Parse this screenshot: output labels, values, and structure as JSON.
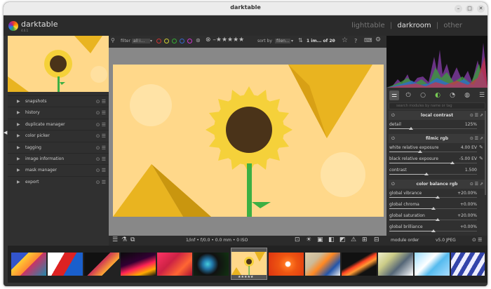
{
  "window": {
    "title": "darktable"
  },
  "app": {
    "name": "darktable",
    "version": "4.6.1"
  },
  "views": {
    "lighttable": "lighttable",
    "darkroom": "darkroom",
    "other": "other",
    "sep": "|"
  },
  "left_panel": {
    "items": [
      {
        "label": "snapshots"
      },
      {
        "label": "history"
      },
      {
        "label": "duplicate manager"
      },
      {
        "label": "color picker"
      },
      {
        "label": "tagging"
      },
      {
        "label": "image information"
      },
      {
        "label": "mask manager"
      },
      {
        "label": "export"
      }
    ]
  },
  "topbar": {
    "filter_label": "filter",
    "filter_value": "all i...",
    "sort_label": "sort by",
    "sort_value": "filen...",
    "count": "1 im... of 20",
    "help": "?",
    "color_labels": [
      "#cc3333",
      "#cccc33",
      "#33aa33",
      "#3366cc",
      "#cc33cc"
    ]
  },
  "bottombar": {
    "exif": "1/inf • f/0.0 • 0.0 mm • 0 ISO"
  },
  "right_panel": {
    "search_placeholder": "search modules by name or tag",
    "modules": {
      "local_contrast": {
        "title": "local contrast",
        "params": [
          {
            "label": "detail",
            "value": "125%",
            "level": 0.25
          }
        ]
      },
      "filmic_rgb": {
        "title": "filmic rgb",
        "params": [
          {
            "label": "white relative exposure",
            "value": "4.00 EV",
            "level": 0.35
          },
          {
            "label": "black relative exposure",
            "value": "-5.00 EV",
            "level": 0.72
          },
          {
            "label": "contrast",
            "value": "1.500",
            "level": 0.42
          }
        ]
      },
      "color_balance_rgb": {
        "title": "color balance rgb",
        "params": [
          {
            "label": "global vibrance",
            "value": "+20.00%",
            "level": 0.55
          },
          {
            "label": "global chroma",
            "value": "+0.00%",
            "level": 0.5
          },
          {
            "label": "global saturation",
            "value": "+20.00%",
            "level": 0.55
          },
          {
            "label": "global brilliance",
            "value": "+0.00%",
            "level": 0.5
          }
        ]
      }
    },
    "module_order_label": "module order",
    "module_order_value": "v5.0 JPEG"
  },
  "filmstrip": {
    "selected_index": 6,
    "stars": "★★★★★"
  },
  "colors": {
    "accent": "#e0e0e0",
    "bg": "#333333",
    "image_bg": "#ffd88a",
    "sunflower": "#f5d13a"
  }
}
